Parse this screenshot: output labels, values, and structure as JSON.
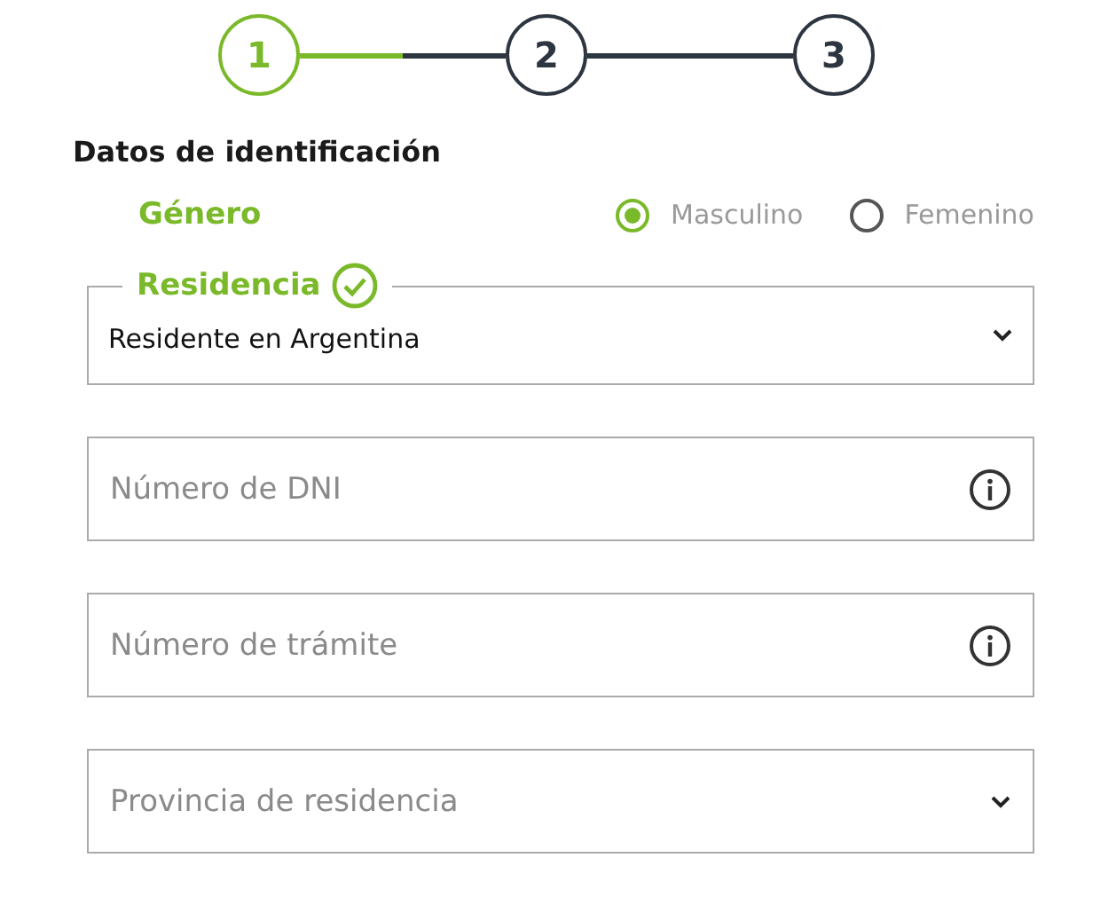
{
  "stepper": {
    "steps": [
      {
        "label": "1",
        "selected": true,
        "connector": {
          "level": 0.5
        }
      },
      {
        "label": "2",
        "selected": false
      },
      {
        "label": "3",
        "selected": false
      }
    ]
  },
  "section_title": "Datos de identificación",
  "gender": {
    "label": "Género",
    "options": [
      {
        "label": "Masculino",
        "selected": true
      },
      {
        "label": "Femenino",
        "selected": false
      }
    ]
  },
  "fields": [
    {
      "kind": "select",
      "label": "Residencia",
      "valid": true,
      "value": "Residente en Argentina"
    },
    {
      "kind": "input",
      "placeholder": "Número de DNI"
    },
    {
      "kind": "input",
      "placeholder": "Número de trámite"
    },
    {
      "kind": "select",
      "placeholder": "Provincia de residencia"
    }
  ]
}
